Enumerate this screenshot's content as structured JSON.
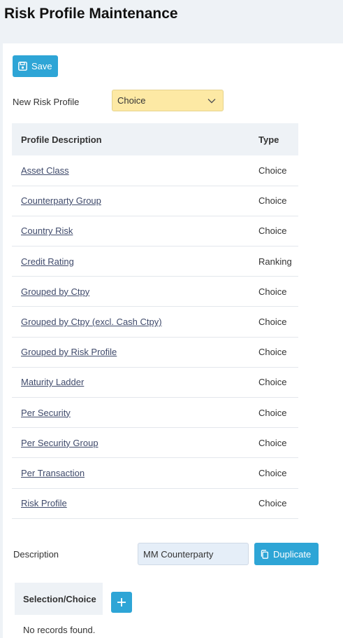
{
  "page": {
    "title": "Risk Profile Maintenance"
  },
  "toolbar": {
    "save_label": "Save"
  },
  "new_profile": {
    "label": "New Risk Profile",
    "selected": "Choice"
  },
  "profile_table": {
    "headers": [
      "Profile Description",
      "Type"
    ],
    "rows": [
      {
        "description": "Asset Class",
        "type": "Choice"
      },
      {
        "description": "Counterparty Group",
        "type": "Choice"
      },
      {
        "description": "Country Risk",
        "type": "Choice"
      },
      {
        "description": "Credit Rating",
        "type": "Ranking"
      },
      {
        "description": "Grouped by Ctpy",
        "type": "Choice"
      },
      {
        "description": "Grouped by Ctpy (excl. Cash Ctpy)",
        "type": "Choice"
      },
      {
        "description": "Grouped by Risk Profile",
        "type": "Choice"
      },
      {
        "description": "Maturity Ladder",
        "type": "Choice"
      },
      {
        "description": "Per Security",
        "type": "Choice"
      },
      {
        "description": "Per Security Group",
        "type": "Choice"
      },
      {
        "description": "Per Transaction",
        "type": "Choice"
      },
      {
        "description": "Risk Profile",
        "type": "Choice"
      }
    ]
  },
  "description": {
    "label": "Description",
    "value": "MM Counterparty",
    "duplicate_label": "Duplicate"
  },
  "selection": {
    "header": "Selection/Choice",
    "empty_message": "No records found."
  },
  "colors": {
    "accent": "#2ea5d6",
    "select_bg": "#fde9a4",
    "header_bg": "#eef2f6",
    "link": "#3f4a6b"
  }
}
